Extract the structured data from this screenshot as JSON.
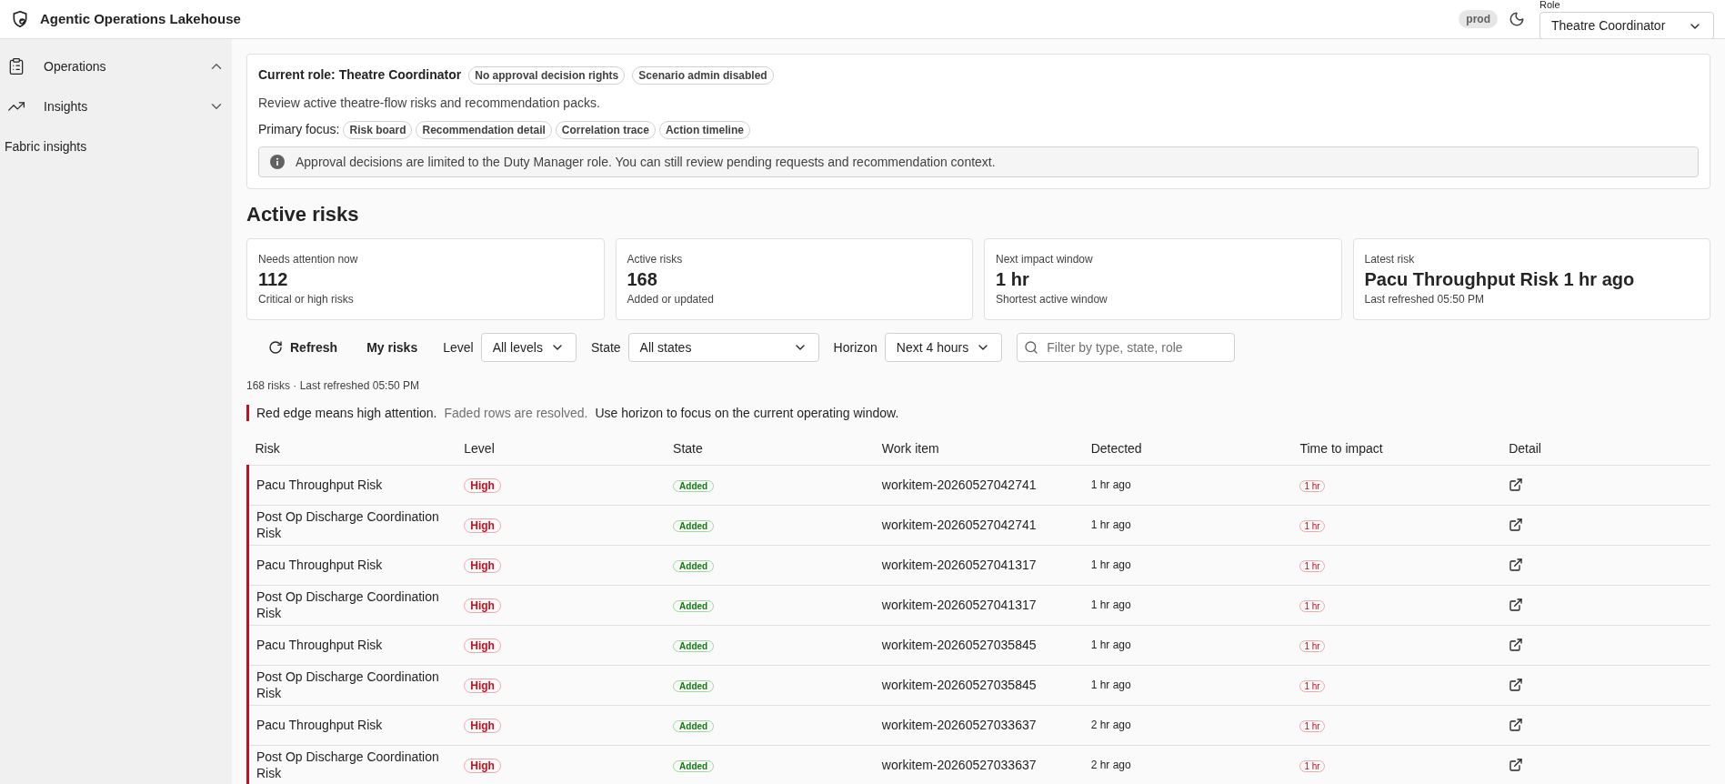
{
  "app": {
    "title": "Agentic Operations Lakehouse",
    "environment": "prod",
    "role_label": "Role",
    "role_value": "Theatre Coordinator"
  },
  "sidebar": {
    "groups": [
      {
        "label": "Operations",
        "expanded": true
      },
      {
        "label": "Insights",
        "expanded": false
      }
    ],
    "links": [
      "Fabric insights"
    ]
  },
  "role_card": {
    "title": "Current role: Theatre Coordinator",
    "badges": [
      "No approval decision rights",
      "Scenario admin disabled"
    ],
    "description": "Review active theatre-flow risks and recommendation packs.",
    "focus_label": "Primary focus:",
    "focus": [
      "Risk board",
      "Recommendation detail",
      "Correlation trace",
      "Action timeline"
    ],
    "notice": "Approval decisions are limited to the Duty Manager role. You can still review pending requests and recommendation context."
  },
  "heading": "Active risks",
  "kpis": [
    {
      "label": "Needs attention now",
      "value": "112",
      "note": "Critical or high risks"
    },
    {
      "label": "Active risks",
      "value": "168",
      "note": "Added or updated"
    },
    {
      "label": "Next impact window",
      "value": "1 hr",
      "note": "Shortest active window"
    },
    {
      "label": "Latest risk",
      "value": "Pacu Throughput Risk 1 hr ago",
      "note": "Last refreshed 05:50 PM"
    }
  ],
  "toolbar": {
    "refresh": "Refresh",
    "my_risks": "My risks",
    "filters": [
      {
        "label": "Level",
        "value": "All levels"
      },
      {
        "label": "State",
        "value": "All states"
      },
      {
        "label": "Horizon",
        "value": "Next 4 hours"
      }
    ],
    "search_placeholder": "Filter by type, state, role"
  },
  "summary": "168 risks · Last refreshed 05:50 PM",
  "legend": {
    "main": "Red edge means high attention.",
    "faded": "Faded rows are resolved.",
    "hint": "Use horizon to focus on the current operating window."
  },
  "table": {
    "columns": [
      "Risk",
      "Level",
      "State",
      "Work item",
      "Detected",
      "Time to impact",
      "Detail"
    ],
    "rows": [
      {
        "risk": "Pacu Throughput Risk",
        "level": "High",
        "state": "Added",
        "work_item": "workitem-20260527042741",
        "detected": "1 hr ago",
        "impact": "1 hr",
        "high_attention": true,
        "resolved": false
      },
      {
        "risk": "Post Op Discharge Coordination Risk",
        "level": "High",
        "state": "Added",
        "work_item": "workitem-20260527042741",
        "detected": "1 hr ago",
        "impact": "1 hr",
        "high_attention": true,
        "resolved": false
      },
      {
        "risk": "Pacu Throughput Risk",
        "level": "High",
        "state": "Added",
        "work_item": "workitem-20260527041317",
        "detected": "1 hr ago",
        "impact": "1 hr",
        "high_attention": true,
        "resolved": false
      },
      {
        "risk": "Post Op Discharge Coordination Risk",
        "level": "High",
        "state": "Added",
        "work_item": "workitem-20260527041317",
        "detected": "1 hr ago",
        "impact": "1 hr",
        "high_attention": true,
        "resolved": false
      },
      {
        "risk": "Pacu Throughput Risk",
        "level": "High",
        "state": "Added",
        "work_item": "workitem-20260527035845",
        "detected": "1 hr ago",
        "impact": "1 hr",
        "high_attention": true,
        "resolved": false
      },
      {
        "risk": "Post Op Discharge Coordination Risk",
        "level": "High",
        "state": "Added",
        "work_item": "workitem-20260527035845",
        "detected": "1 hr ago",
        "impact": "1 hr",
        "high_attention": true,
        "resolved": false
      },
      {
        "risk": "Pacu Throughput Risk",
        "level": "High",
        "state": "Added",
        "work_item": "workitem-20260527033637",
        "detected": "2 hr ago",
        "impact": "1 hr",
        "high_attention": true,
        "resolved": false
      },
      {
        "risk": "Post Op Discharge Coordination Risk",
        "level": "High",
        "state": "Added",
        "work_item": "workitem-20260527033637",
        "detected": "2 hr ago",
        "impact": "1 hr",
        "high_attention": true,
        "resolved": false
      }
    ]
  }
}
